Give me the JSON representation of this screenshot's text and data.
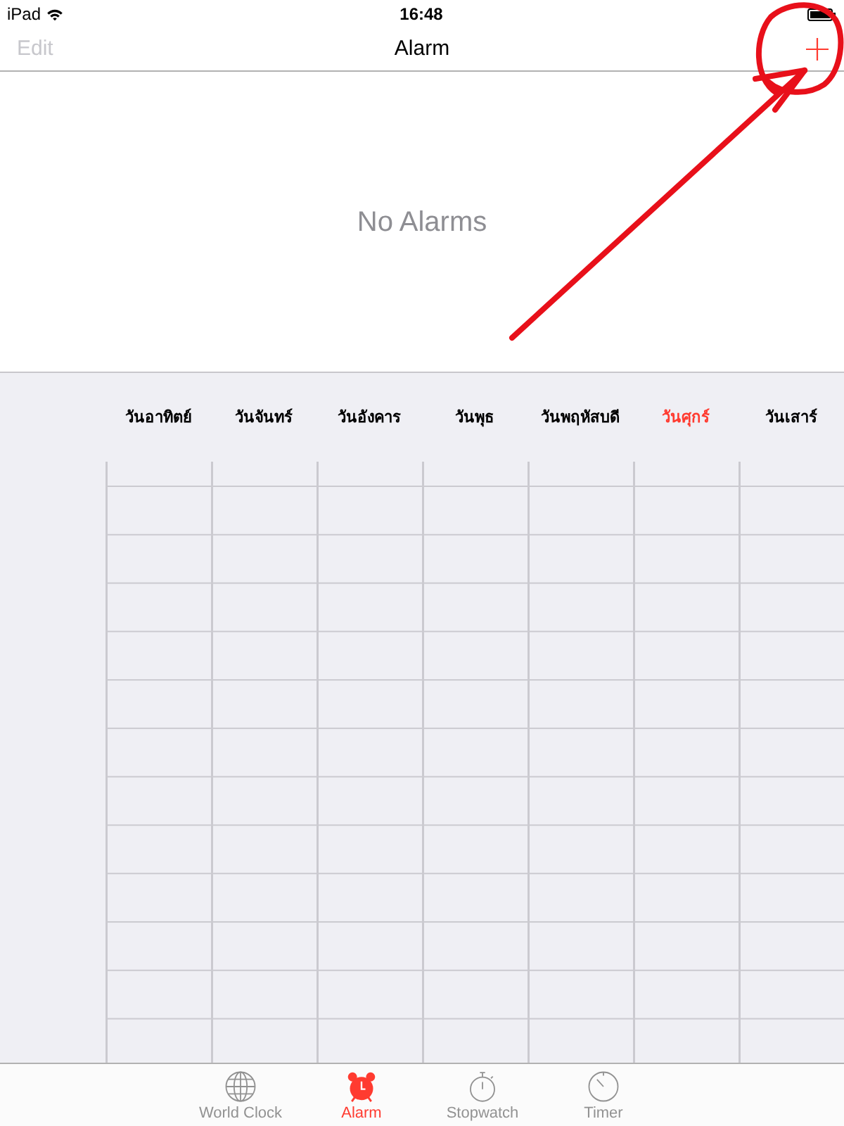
{
  "status_bar": {
    "carrier": "iPad",
    "time": "16:48"
  },
  "nav_bar": {
    "edit_button": {
      "label": "Edit",
      "disabled": true
    },
    "title": "Alarm"
  },
  "empty_state": {
    "message": "No Alarms"
  },
  "week_days": [
    {
      "label": "วันอาทิตย์",
      "selected": false
    },
    {
      "label": "วันจันทร์",
      "selected": false
    },
    {
      "label": "วันอังคาร",
      "selected": false
    },
    {
      "label": "วันพุธ",
      "selected": false
    },
    {
      "label": "วันพฤหัสบดี",
      "selected": false
    },
    {
      "label": "วันศุกร์",
      "selected": true
    },
    {
      "label": "วันเสาร์",
      "selected": false
    }
  ],
  "tab_bar": [
    {
      "label": "World Clock",
      "selected": false
    },
    {
      "label": "Alarm",
      "selected": true
    },
    {
      "label": "Stopwatch",
      "selected": false
    },
    {
      "label": "Timer",
      "selected": false
    }
  ]
}
